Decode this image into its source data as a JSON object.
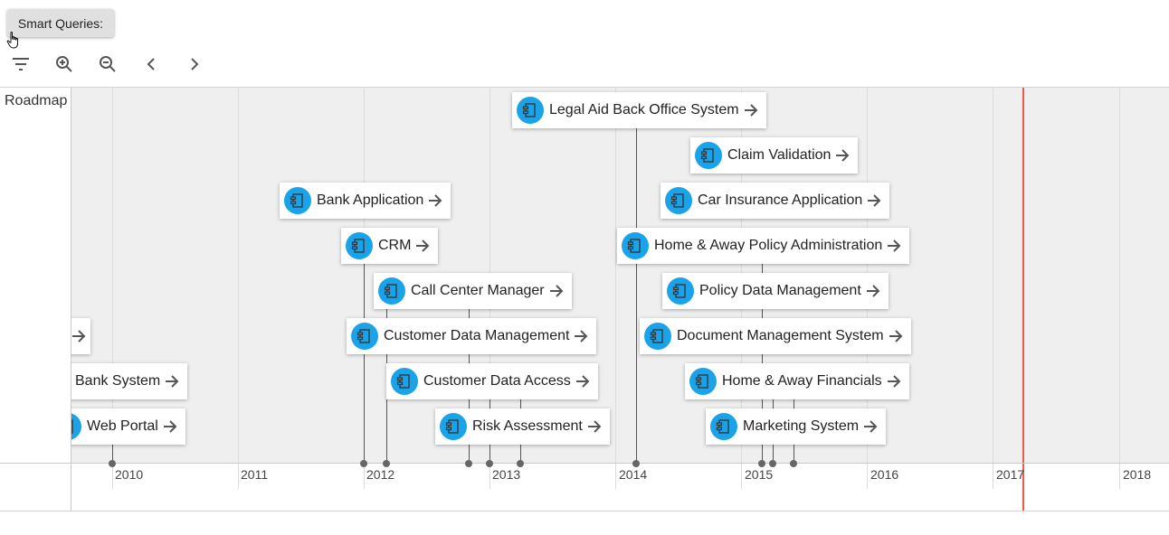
{
  "toolbar": {
    "smart_queries_label": "Smart Queries:",
    "icons": [
      "filter-icon",
      "zoom-in-icon",
      "zoom-out-icon",
      "chevron-left-icon",
      "chevron-right-icon"
    ]
  },
  "roadmap": {
    "lane_label": "Roadmap",
    "years": [
      "2010",
      "2011",
      "2012",
      "2013",
      "2014",
      "2015",
      "2016",
      "2017",
      "2018"
    ],
    "colors": {
      "app_icon": "#1aa3e8",
      "today_line": "#f05a4a",
      "lane_bg": "#efefef"
    },
    "items": [
      {
        "label": "Legal Aid Back Office System"
      },
      {
        "label": "Claim Validation"
      },
      {
        "label": "Bank Application"
      },
      {
        "label": "Car Insurance Application"
      },
      {
        "label": "CRM"
      },
      {
        "label": "Home & Away Policy Administration"
      },
      {
        "label": "Call Center Manager"
      },
      {
        "label": "Policy Data Management"
      },
      {
        "label": ""
      },
      {
        "label": "Customer Data Management"
      },
      {
        "label": "Document Management System"
      },
      {
        "label": "Bank System"
      },
      {
        "label": "Customer Data Access"
      },
      {
        "label": "Home & Away Financials"
      },
      {
        "label": "Web Portal"
      },
      {
        "label": "Risk Assessment"
      },
      {
        "label": "Marketing System"
      }
    ]
  }
}
